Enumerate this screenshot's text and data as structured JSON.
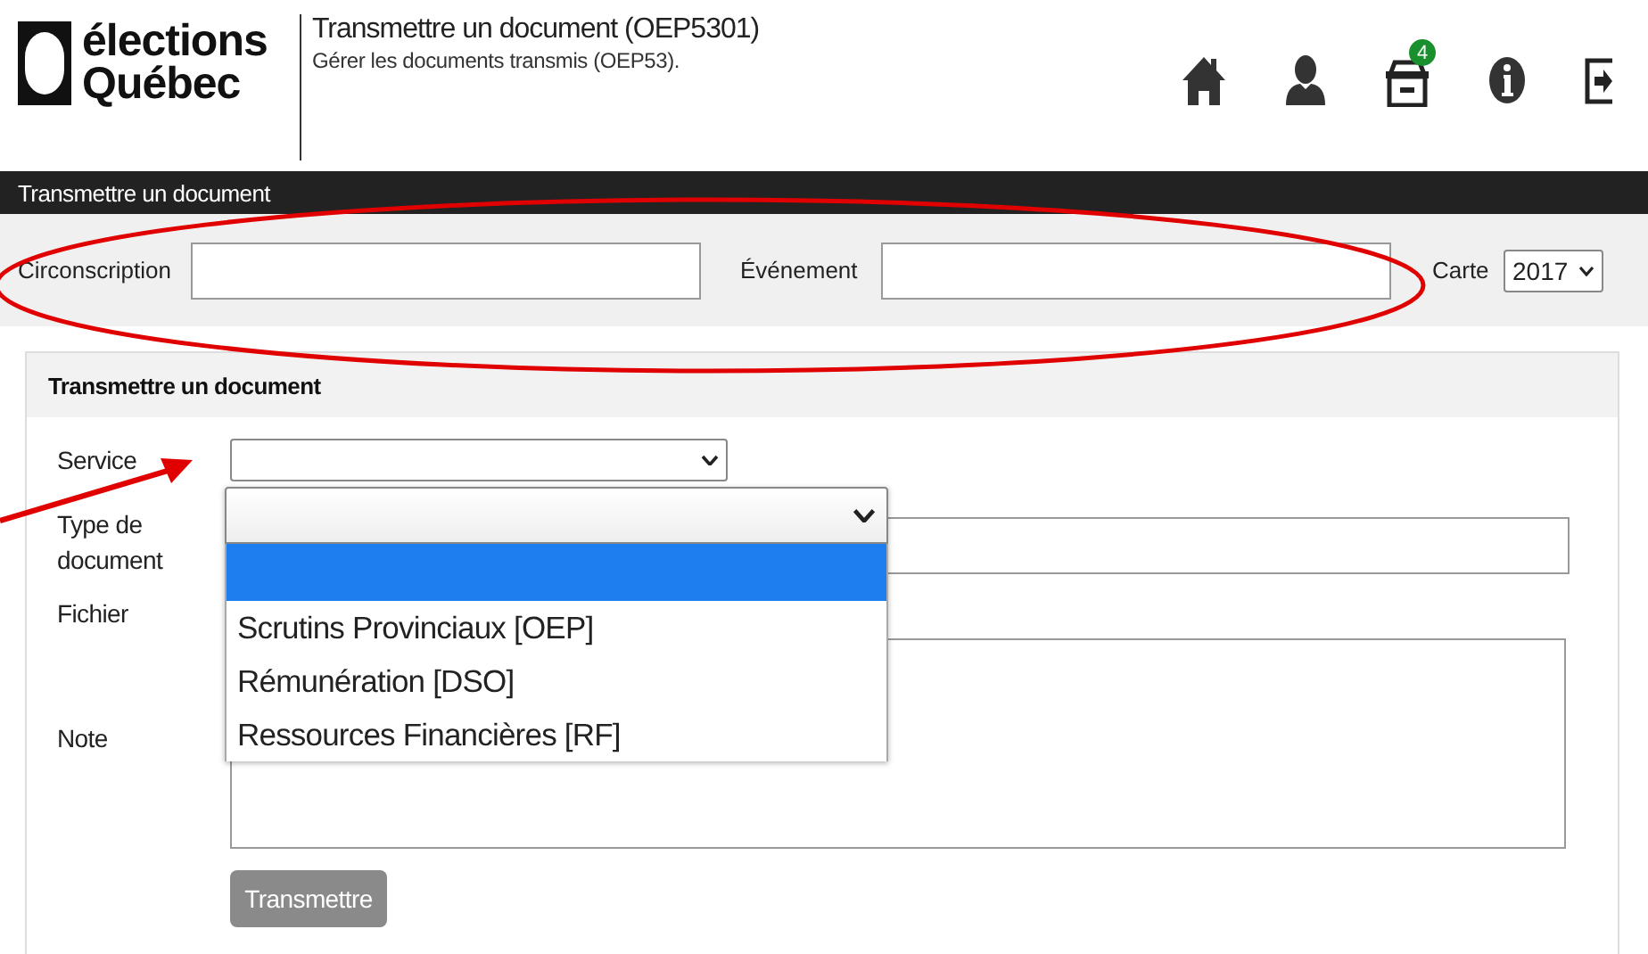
{
  "header": {
    "logo": {
      "line_1": "élections",
      "line_2": "Québec"
    },
    "title": "Transmettre un document (OEP5301)",
    "subtitle": "Gérer les documents transmis (OEP53).",
    "icons": [
      {
        "kind": "home"
      },
      {
        "kind": "user"
      },
      {
        "kind": "archive",
        "badge": "4"
      },
      {
        "kind": "info"
      },
      {
        "kind": "logout"
      }
    ]
  },
  "nav_bar": {
    "title": "Transmettre un document"
  },
  "filters": {
    "circonscription": {
      "label": "Circonscription"
    },
    "evenement": {
      "label": "Événement"
    },
    "carte": {
      "label": "Carte",
      "value": "2017"
    }
  },
  "panel": {
    "title": "Transmettre un document",
    "service": {
      "label": "Service"
    },
    "type_document": {
      "label": "Type de document",
      "expanded": true,
      "options": [
        {
          "selected": true
        },
        {
          "label": "Scrutins Provinciaux [OEP]",
          "selected": false
        },
        {
          "label": "Rémunération [DSO]",
          "selected": false
        },
        {
          "label": "Ressources Financières [RF]",
          "selected": false
        }
      ]
    },
    "fichier": {
      "label": "Fichier"
    },
    "note": {
      "label": "Note"
    },
    "submit": {
      "label": "Transmettre",
      "disabled": true
    }
  },
  "annotations": {
    "ellipse": {
      "color": "#e00000"
    },
    "arrow": {
      "color": "#e00000"
    }
  }
}
